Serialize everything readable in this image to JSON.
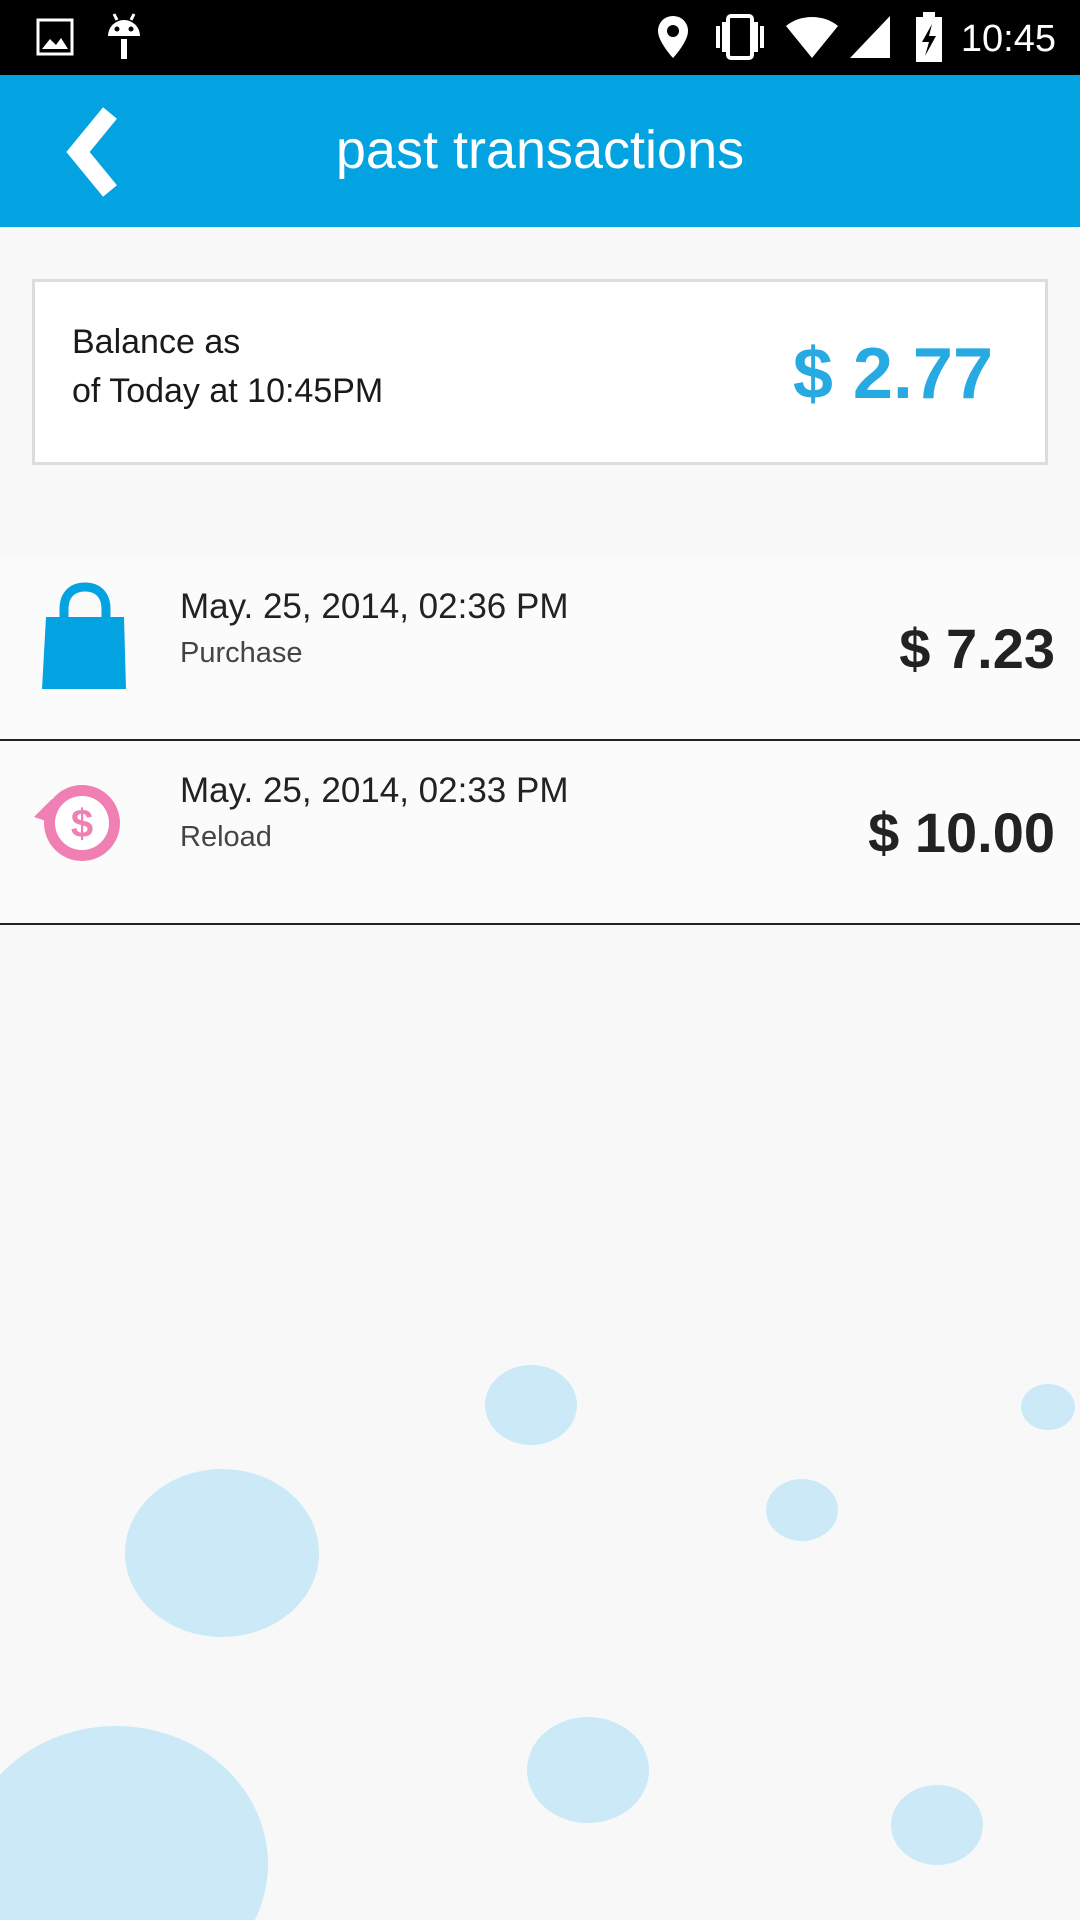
{
  "status_bar": {
    "time": "10:45",
    "icons": [
      "image-icon",
      "android-icon",
      "location-icon",
      "vibrate-icon",
      "wifi-icon",
      "signal-icon",
      "battery-charging-icon"
    ]
  },
  "header": {
    "title": "past transactions",
    "back_icon": "chevron-left-icon"
  },
  "balance": {
    "label_line1": "Balance as",
    "label_line2": "of Today at  10:45PM",
    "amount": "$ 2.77"
  },
  "transactions": [
    {
      "date": "May. 25, 2014, 02:36 PM",
      "type": "Purchase",
      "amount": "$ 7.23",
      "icon": "shopping-bag-icon"
    },
    {
      "date": "May. 25, 2014, 02:33 PM",
      "type": "Reload",
      "amount": "$ 10.00",
      "icon": "reload-dollar-icon"
    }
  ],
  "colors": {
    "accent": "#03a3e2",
    "balance_amount": "#27a9e1",
    "reload_icon": "#f080b4",
    "bubble": "#cbe9f7"
  }
}
